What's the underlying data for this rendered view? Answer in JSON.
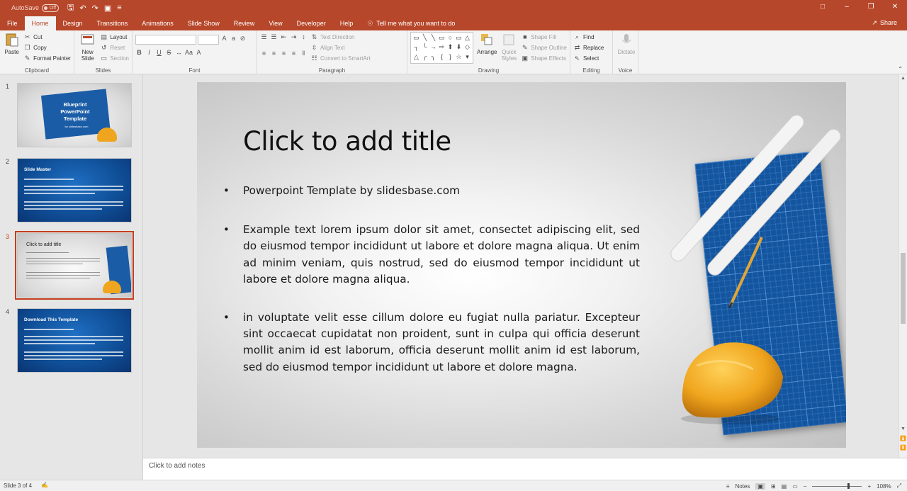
{
  "titlebar": {
    "autosave_label": "AutoSave",
    "autosave_state": "Off",
    "qat_icons": [
      "save-icon",
      "undo-icon",
      "redo-icon",
      "present-icon",
      "customize-icon"
    ]
  },
  "tabs": [
    "File",
    "Home",
    "Design",
    "Transitions",
    "Animations",
    "Slide Show",
    "Review",
    "View",
    "Developer",
    "Help"
  ],
  "active_tab": "Home",
  "tell_me": "Tell me what you want to do",
  "share_label": "Share",
  "ribbon": {
    "clipboard": {
      "label": "Clipboard",
      "paste": "Paste",
      "cut": "Cut",
      "copy": "Copy",
      "format_painter": "Format Painter"
    },
    "slides": {
      "label": "Slides",
      "new_slide": "New Slide",
      "layout": "Layout",
      "reset": "Reset",
      "section": "Section"
    },
    "font": {
      "label": "Font"
    },
    "paragraph": {
      "label": "Paragraph",
      "text_direction": "Text Direction",
      "align_text": "Align Text",
      "convert_smartart": "Convert to SmartArt"
    },
    "drawing": {
      "label": "Drawing",
      "arrange": "Arrange",
      "quick_styles": "Quick Styles",
      "shape_fill": "Shape Fill",
      "shape_outline": "Shape Outline",
      "shape_effects": "Shape Effects"
    },
    "editing": {
      "label": "Editing",
      "find": "Find",
      "replace": "Replace",
      "select": "Select"
    },
    "voice": {
      "label": "Voice",
      "dictate": "Dictate"
    }
  },
  "thumbnails": [
    {
      "num": "1",
      "title": "Blueprint PowerPoint Template",
      "subtitle": "by slidesbase.com"
    },
    {
      "num": "2",
      "title": "Slide Master"
    },
    {
      "num": "3",
      "title": "Click to add title"
    },
    {
      "num": "4",
      "title": "Download This Template"
    }
  ],
  "selected_slide": 3,
  "slide": {
    "title": "Click to add title",
    "bullets": [
      "Powerpoint Template by slidesbase.com",
      "Example text lorem ipsum dolor sit amet, consectet adipiscing elit, sed do eiusmod tempor incididunt ut labore et dolore magna aliqua. Ut enim ad minim veniam, quis nostrud, sed do eiusmod tempor incididunt ut labore et dolore magna aliqua.",
      "in voluptate velit esse cillum dolore eu fugiat nulla pariatur. Excepteur sint occaecat cupidatat non proident, sunt in culpa qui officia deserunt mollit anim id est laborum, officia deserunt mollit anim id est laborum, sed do eiusmod tempor incididunt ut labore et dolore magna."
    ]
  },
  "notes_placeholder": "Click to add notes",
  "statusbar": {
    "slide_info": "Slide 3 of 4",
    "notes_label": "Notes",
    "zoom": "108%"
  },
  "colors": {
    "accent": "#b7472a",
    "selection": "#c43e1c",
    "blueprint": "#1455a0",
    "helmet": "#f0a51e"
  }
}
